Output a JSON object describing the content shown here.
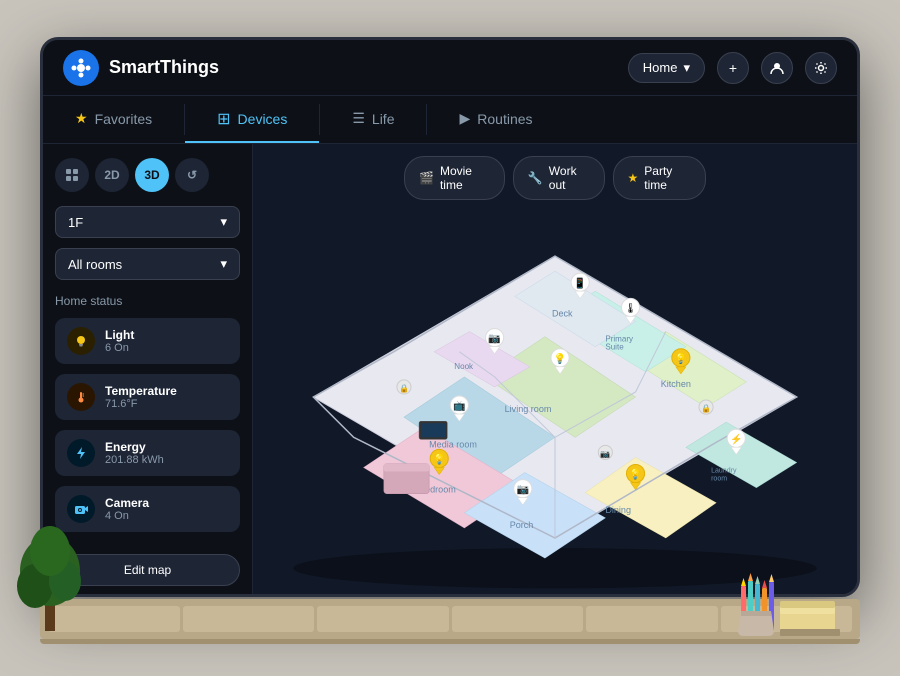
{
  "app": {
    "name": "SmartThings",
    "logo_symbol": "✦"
  },
  "header": {
    "home_label": "Home",
    "add_btn": "+",
    "profile_icon": "👤",
    "settings_icon": "⚙"
  },
  "nav": {
    "tabs": [
      {
        "id": "favorites",
        "label": "Favorites",
        "icon": "★",
        "active": false
      },
      {
        "id": "devices",
        "label": "Devices",
        "icon": "⊞",
        "active": true
      },
      {
        "id": "life",
        "label": "Life",
        "icon": "☰",
        "active": false
      },
      {
        "id": "routines",
        "label": "Routines",
        "icon": "▶",
        "active": false
      }
    ]
  },
  "sidebar": {
    "view_buttons": [
      {
        "id": "grid",
        "label": "⊞",
        "active": false
      },
      {
        "id": "2d",
        "label": "2D",
        "active": false
      },
      {
        "id": "3d",
        "label": "3D",
        "active": true
      },
      {
        "id": "history",
        "label": "↺",
        "active": false
      }
    ],
    "floor_select": {
      "label": "1F",
      "chevron": "▾"
    },
    "room_select": {
      "label": "All rooms",
      "chevron": "▾"
    },
    "home_status_title": "Home status",
    "status_items": [
      {
        "id": "light",
        "icon": "💡",
        "icon_bg": "#f5c518",
        "label": "Light",
        "value": "6 On"
      },
      {
        "id": "temperature",
        "icon": "🌡",
        "icon_bg": "#ff8c42",
        "label": "Temperature",
        "value": "71.6°F"
      },
      {
        "id": "energy",
        "icon": "⚡",
        "icon_bg": "#4fc3f7",
        "label": "Energy",
        "value": "201.88 kWh"
      },
      {
        "id": "camera",
        "icon": "📷",
        "icon_bg": "#4fc3f7",
        "label": "Camera",
        "value": "4 On"
      }
    ],
    "edit_map_label": "Edit map"
  },
  "quick_actions": [
    {
      "id": "movie",
      "icon": "🎬",
      "label": "Movie time"
    },
    {
      "id": "workout",
      "icon": "🔧",
      "label": "Work out"
    },
    {
      "id": "party",
      "icon": "⭐",
      "label": "Party time"
    }
  ],
  "colors": {
    "bg_dark": "#0d1117",
    "bg_medium": "#111827",
    "bg_card": "#1e2535",
    "accent_blue": "#4fc3f7",
    "text_muted": "#8899aa",
    "border": "#1e2535"
  }
}
